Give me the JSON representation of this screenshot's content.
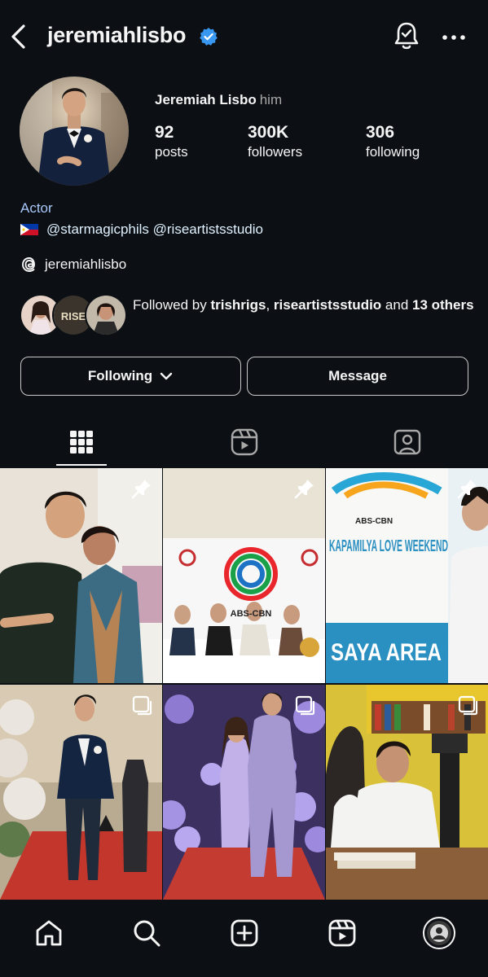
{
  "header": {
    "username": "jeremiahlisbo",
    "icons": [
      "back-arrow-icon",
      "verified-badge-icon",
      "notification-bell-icon",
      "more-options-icon"
    ]
  },
  "profile": {
    "full_name": "Jeremiah Lisbo",
    "pronoun": "him",
    "stats": [
      {
        "value": "92",
        "label": "posts"
      },
      {
        "value": "300K",
        "label": "followers"
      },
      {
        "value": "306",
        "label": "following"
      }
    ],
    "category": "Actor",
    "bio_mentions": "@starmagicphils @riseartistsstudio",
    "threads_handle": "jeremiahlisbo",
    "followed_by": {
      "prefix": "Followed by ",
      "user1": "trishrigs",
      "sep": ", ",
      "user2": "riseartistsstudio",
      "and": " and ",
      "others": "13 others"
    }
  },
  "actions": {
    "following_label": "Following",
    "message_label": "Message"
  },
  "tabs": [
    "grid-icon",
    "reels-icon",
    "tagged-icon"
  ],
  "grid_posts": [
    {
      "pinned": true,
      "post_text": ""
    },
    {
      "pinned": true,
      "post_text": "ABS-CBN"
    },
    {
      "pinned": true,
      "post_text": "KAPAMILYA LOVE WEEKEND",
      "post_sub": "ABS-CBN",
      "post_sub2": "SAYA AREA"
    },
    {
      "pinned": false,
      "multi": true,
      "post_text": ""
    },
    {
      "pinned": false,
      "multi": true,
      "post_text": ""
    },
    {
      "pinned": false,
      "multi": true,
      "post_text": ""
    }
  ],
  "bottom_nav": [
    "home-icon",
    "search-icon",
    "create-icon",
    "reels-icon",
    "profile-avatar"
  ],
  "colors": {
    "background": "#0c1014",
    "accent_blue": "#3897f0",
    "link": "#e0f1ff"
  }
}
